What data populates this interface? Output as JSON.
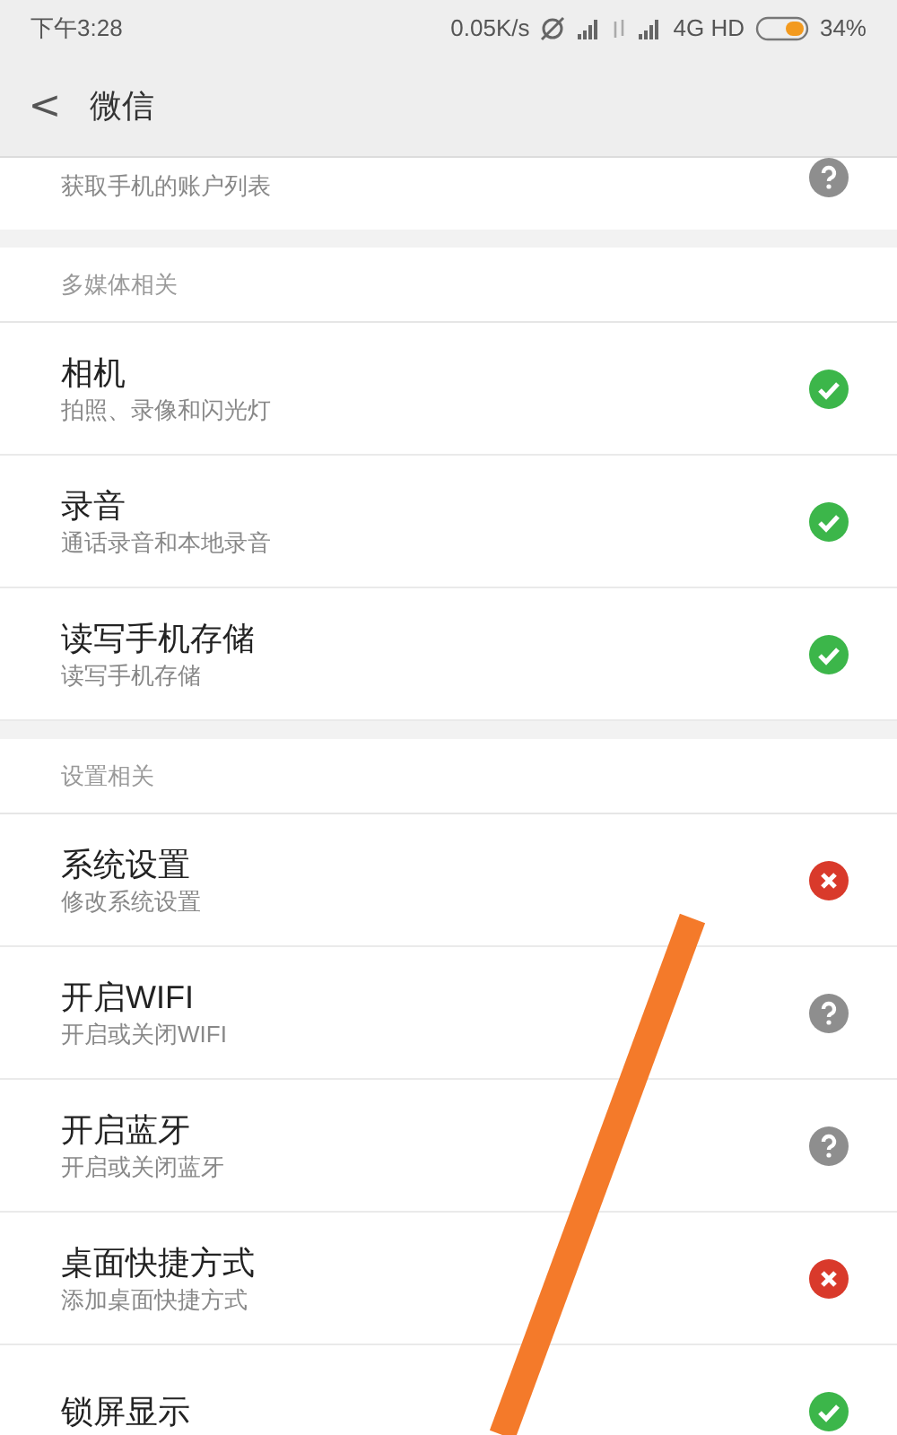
{
  "status_bar": {
    "time": "下午3:28",
    "speed": "0.05K/s",
    "network": "4G HD",
    "battery": "34%"
  },
  "header": {
    "back": "<",
    "title": "微信"
  },
  "partial_row": {
    "subtitle": "获取手机的账户列表",
    "kind": "ask"
  },
  "sections": [
    {
      "title": "多媒体相关",
      "items": [
        {
          "title": "相机",
          "subtitle": "拍照、录像和闪光灯",
          "kind": "allowed"
        },
        {
          "title": "录音",
          "subtitle": "通话录音和本地录音",
          "kind": "allowed"
        },
        {
          "title": "读写手机存储",
          "subtitle": "读写手机存储",
          "kind": "allowed"
        }
      ]
    },
    {
      "title": "设置相关",
      "items": [
        {
          "title": "系统设置",
          "subtitle": "修改系统设置",
          "kind": "denied"
        },
        {
          "title": "开启WIFI",
          "subtitle": "开启或关闭WIFI",
          "kind": "ask"
        },
        {
          "title": "开启蓝牙",
          "subtitle": "开启或关闭蓝牙",
          "kind": "ask"
        },
        {
          "title": "桌面快捷方式",
          "subtitle": "添加桌面快捷方式",
          "kind": "denied"
        },
        {
          "title": "锁屏显示",
          "kind": "allowed"
        }
      ]
    }
  ]
}
